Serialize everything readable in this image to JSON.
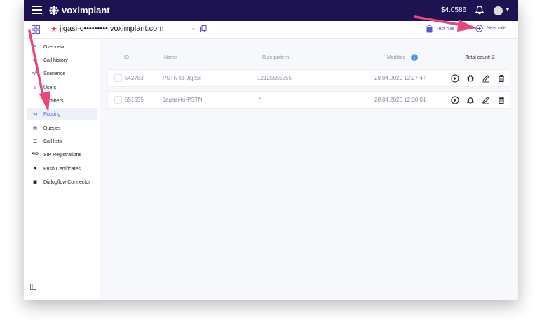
{
  "topbar": {
    "brand": "voximplant",
    "balance": "$4.0586"
  },
  "subbar": {
    "app_name": "jigasi-c•••••••••.voximplant.com",
    "test_rule": "Test rule",
    "new_rule": "New rule"
  },
  "sidebar": {
    "items": [
      {
        "label": "Overview",
        "icon": "overview-icon"
      },
      {
        "label": "Call history",
        "icon": "call-history-icon"
      },
      {
        "label": "Scenarios",
        "icon": "code-icon"
      },
      {
        "label": "Users",
        "icon": "users-icon"
      },
      {
        "label": "Numbers",
        "icon": "dialpad-icon"
      },
      {
        "label": "Routing",
        "icon": "routing-icon"
      },
      {
        "label": "Queues",
        "icon": "queues-icon"
      },
      {
        "label": "Call lists",
        "icon": "list-icon"
      },
      {
        "label": "SIP Registrations",
        "icon": "sip-icon"
      },
      {
        "label": "Push Certificates",
        "icon": "certificate-icon"
      },
      {
        "label": "Dialogflow Connector",
        "icon": "dialogflow-icon"
      }
    ],
    "active": "Routing"
  },
  "table": {
    "headers": {
      "id": "ID",
      "name": "Name",
      "pattern": "Rule pattern",
      "modified": "Modified",
      "total": "Total count: 2"
    },
    "rows": [
      {
        "id": "542783",
        "name": "PSTN-to-Jigasi",
        "pattern": "12125555555",
        "modified": "28.04.2020 12:27:47"
      },
      {
        "id": "551655",
        "name": "Jagasi-to-PSTN",
        "pattern": "*",
        "modified": "28.04.2020 12:30:01"
      }
    ]
  },
  "colors": {
    "topbar": "#1c1350",
    "accent": "#5b55d6",
    "arrow": "#e8467c",
    "star": "#e0404a"
  }
}
